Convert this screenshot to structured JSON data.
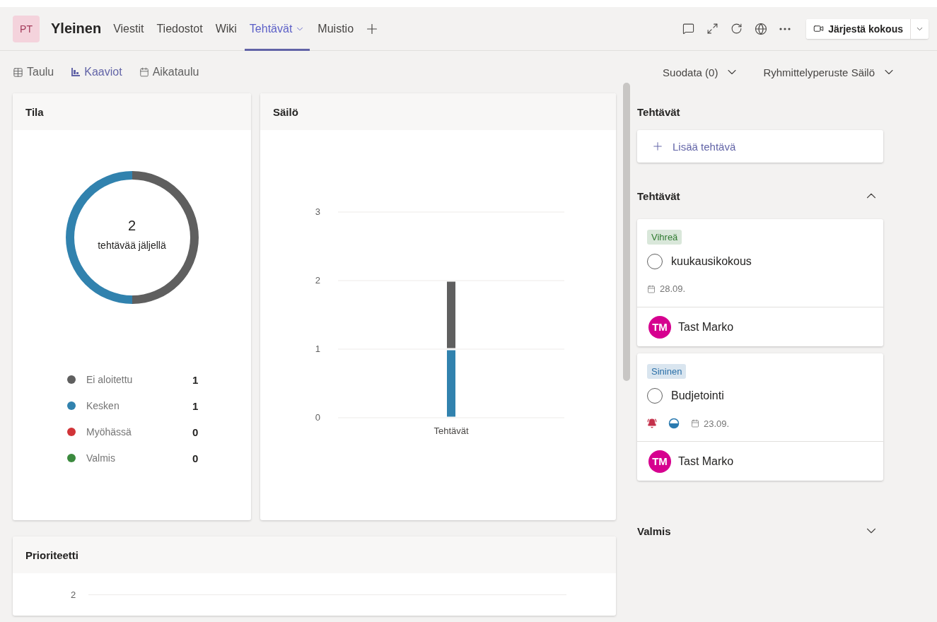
{
  "header": {
    "team_avatar": "PT",
    "channel": "Yleinen",
    "tabs": [
      {
        "label": "Viestit",
        "selected": false
      },
      {
        "label": "Tiedostot",
        "selected": false
      },
      {
        "label": "Wiki",
        "selected": false
      },
      {
        "label": "Tehtävät",
        "selected": true,
        "has_menu": true
      },
      {
        "label": "Muistio",
        "selected": false
      }
    ],
    "meeting_button": "Järjestä kokous"
  },
  "views": [
    {
      "label": "Taulu",
      "kind": "grid",
      "selected": false
    },
    {
      "label": "Kaaviot",
      "kind": "chart",
      "selected": true
    },
    {
      "label": "Aikataulu",
      "kind": "calendar",
      "selected": false
    }
  ],
  "filter": "Suodata (0)",
  "group_by": "Ryhmittelyperuste Säilö",
  "status_card": {
    "title": "Tila",
    "center_count": "2",
    "center_label": "tehtävää jäljellä",
    "legend": [
      {
        "count": "1",
        "color": "#5f5f5f"
      },
      {
        "count": "1",
        "color": "#3182ae"
      },
      {
        "count": "0",
        "color": "#d13438"
      },
      {
        "count": "0",
        "color": "#3b8a3e"
      }
    ],
    "chart_data": {
      "type": "donut",
      "categories": [
        "Ei aloitettu",
        "Kesken",
        "Myöhässä",
        "Valmis"
      ],
      "values": [
        50,
        50,
        0,
        0
      ]
    }
  },
  "bucket_card": {
    "title": "Säilö",
    "chart_data": {
      "type": "bar",
      "categories": [
        "Tehtävät"
      ],
      "series": [
        {
          "color": "#5f5f5f",
          "values": [
            1
          ]
        },
        {
          "color": "#3182ae",
          "values": [
            1
          ]
        }
      ],
      "stacked": true,
      "ylim": [
        0,
        3
      ],
      "yticks": [
        0,
        1,
        2,
        3
      ]
    }
  },
  "priority_card": {
    "title": "Prioriteetti",
    "tick_label": "2"
  },
  "tasks_panel": {
    "title": "Tehtävät",
    "add_label": "Lisää tehtävä",
    "groups": [
      {
        "title": "Tehtävät",
        "expanded": true,
        "tasks": [
          {
            "tag": {
              "label": "Vihreä",
              "color": "#2f7a30"
            },
            "title": "kuukausikokous",
            "completed": false,
            "urgent": false,
            "in_progress": false,
            "due": "28.09.",
            "assignee": {
              "initials": "TM",
              "name": "Tast Marko"
            }
          },
          {
            "tag": {
              "label": "Sininen",
              "color": "#2a6fa8"
            },
            "title": "Budjetointi",
            "completed": false,
            "urgent": true,
            "in_progress": true,
            "due": "23.09.",
            "assignee": {
              "initials": "TM",
              "name": "Tast Marko"
            }
          }
        ]
      },
      {
        "title": "Valmis",
        "expanded": false
      }
    ]
  }
}
